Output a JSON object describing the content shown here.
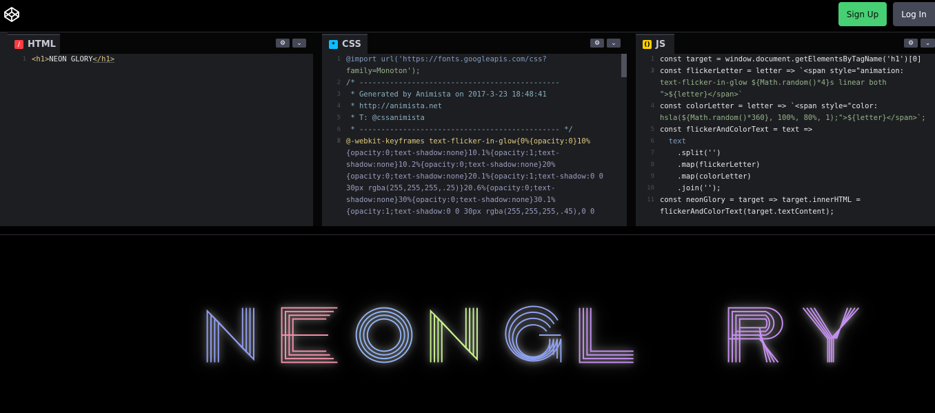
{
  "header": {
    "signup_label": "Sign Up",
    "login_label": "Log In"
  },
  "panels": {
    "html": {
      "label": "HTML",
      "icon": "html-icon"
    },
    "css": {
      "label": "CSS",
      "icon": "css-icon"
    },
    "js": {
      "label": "JS",
      "icon": "js-icon"
    }
  },
  "html_code": {
    "line1": {
      "num": "1",
      "open": "<h1>",
      "text": "NEON GLORY",
      "close": "</h1>"
    }
  },
  "css_code": {
    "l1a": "@import url('https://fonts.googleapis.com/css?",
    "l1b": "family=Monoton');",
    "l2": "/* ----------------------------------------------",
    "l3": " * Generated by Animista on 2017-3-23 18:48:41",
    "l4": " * http://animista.net",
    "l5": " * T: @cssanimista",
    "l6": " * ---------------------------------------------- */",
    "l7": "",
    "l8a": "@-webkit-keyframes text-flicker-in-glow{0%{opacity:0}10%",
    "l8b": "{opacity:0;text-shadow:none}10.1%{opacity:1;text-",
    "l8c": "shadow:none}10.2%{opacity:0;text-shadow:none}20%",
    "l8d": "{opacity:0;text-shadow:none}20.1%{opacity:1;text-shadow:0 0",
    "l8e": "30px rgba(255,255,255,.25)}20.6%{opacity:0;text-",
    "l8f": "shadow:none}30%{opacity:0;text-shadow:none}30.1%",
    "l8g": "{opacity:1;text-shadow:0 0 30px rgba(255,255,255,.45),0 0"
  },
  "js_code": {
    "l1": "const target = window.document.getElementsByTagName('h1')[0]",
    "l2": "",
    "l3a": "const flickerLetter = letter => `<span style=\"animation:",
    "l3b": "text-flicker-in-glow ${Math.random()*4}s linear both",
    "l3c": "\">${letter}</span>`",
    "l4a": "const colorLetter = letter => `<span style=\"color:",
    "l4b": "hsla(${Math.random()*360}, 100%, 80%, 1);\">${letter}</span>`;",
    "l5": "const flickerAndColorText = text =>",
    "l6": "  text",
    "l7": "    .split('')",
    "l8": "    .map(flickerLetter)",
    "l9": "    .map(colorLetter)",
    "l10": "    .join('');",
    "l11a": "const neonGlory = target => target.innerHTML =",
    "l11b": "flickerAndColorText(target.textContent);"
  },
  "preview": {
    "letters": [
      {
        "ch": "N",
        "color": "#8f9cf0"
      },
      {
        "ch": "E",
        "color": "#f48fa8"
      },
      {
        "ch": "O",
        "color": "#8fb2f2"
      },
      {
        "ch": "N",
        "color": "#c5f28a"
      },
      {
        "ch": "G",
        "color": "#8fa2f2"
      },
      {
        "ch": "L",
        "color": "#c58ff2"
      },
      {
        "ch": " ",
        "color": "#000000"
      },
      {
        "ch": "R",
        "color": "#c88ff2"
      },
      {
        "ch": "Y",
        "color": "#c58ff2"
      }
    ]
  },
  "colors": {
    "signup_bg": "#47cf73",
    "login_bg": "#444857",
    "editor_bg": "#1d1e22"
  }
}
